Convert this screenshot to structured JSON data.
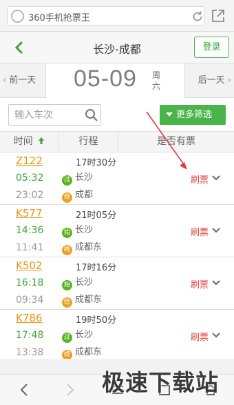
{
  "browser": {
    "address": "360手机抢票王"
  },
  "header": {
    "title": "长沙-成都",
    "login_label": "登录"
  },
  "date_bar": {
    "prev_label": "前一天",
    "next_label": "后一天",
    "date": "05-09",
    "weekday_1": "周",
    "weekday_2": "六"
  },
  "filter": {
    "search_placeholder": "输入车次",
    "more_label": "更多筛选"
  },
  "columns": {
    "time": "时间",
    "route": "行程",
    "ticket": "是否有票"
  },
  "trains": [
    {
      "no": "Z122",
      "duration": "17时30分",
      "dep_time": "05:32",
      "arr_time": "23:02",
      "from_badge": "过",
      "from": "长沙",
      "to_badge": "终",
      "to": "成都",
      "action": "刷票"
    },
    {
      "no": "K577",
      "duration": "21时05分",
      "dep_time": "14:36",
      "arr_time": "11:41",
      "from_badge": "始",
      "from": "长沙",
      "to_badge": "终",
      "to": "成都东",
      "action": "刷票"
    },
    {
      "no": "K502",
      "duration": "17时16分",
      "dep_time": "16:18",
      "arr_time": "09:34",
      "from_badge": "始",
      "from": "长沙",
      "to_badge": "终",
      "to": "成都东",
      "action": "刷票"
    },
    {
      "no": "K786",
      "duration": "19时50分",
      "dep_time": "17:48",
      "arr_time": "13:38",
      "from_badge": "过",
      "from": "长沙",
      "to_badge": "终",
      "to": "成都东",
      "action": "刷票"
    }
  ],
  "watermark": "极速下载站",
  "colors": {
    "accent_green": "#4ab34a",
    "train_no_orange": "#e7960f",
    "departure_green": "#3aa33a",
    "refresh_red": "#e64340"
  }
}
